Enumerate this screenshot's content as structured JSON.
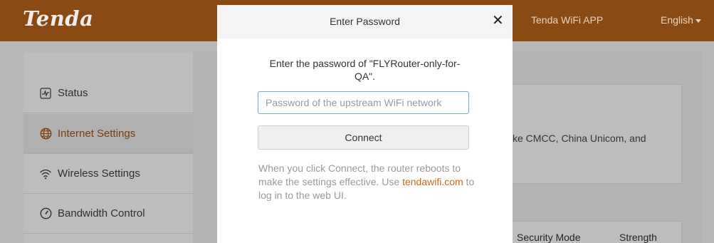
{
  "header": {
    "logo": "Tenda",
    "app_link": "Tenda WiFi APP",
    "language": "English"
  },
  "sidebar": {
    "items": [
      {
        "label": "Status",
        "icon": "status-chart-icon"
      },
      {
        "label": "Internet Settings",
        "icon": "globe-icon",
        "active": true
      },
      {
        "label": "Wireless Settings",
        "icon": "wifi-icon"
      },
      {
        "label": "Bandwidth Control",
        "icon": "gauge-icon"
      }
    ]
  },
  "background": {
    "isp_text": "ke CMCC, China Unicom, and",
    "columns": [
      "Security Mode",
      "Strength"
    ]
  },
  "modal": {
    "title": "Enter Password",
    "prompt": "Enter the password of \"FLYRouter-only-for-QA\".",
    "password_placeholder": "Password of the upstream WiFi network",
    "password_value": "",
    "connect_label": "Connect",
    "note_part1": "When you click Connect, the router reboots to make the settings effective. Use ",
    "note_link": "tendawifi.com",
    "note_part2": " to log in to the web UI."
  },
  "colors": {
    "brand_orange": "#c76b1f",
    "header_dimmed": "#8a4a14",
    "overlay_gray": "#b7b7b7"
  }
}
